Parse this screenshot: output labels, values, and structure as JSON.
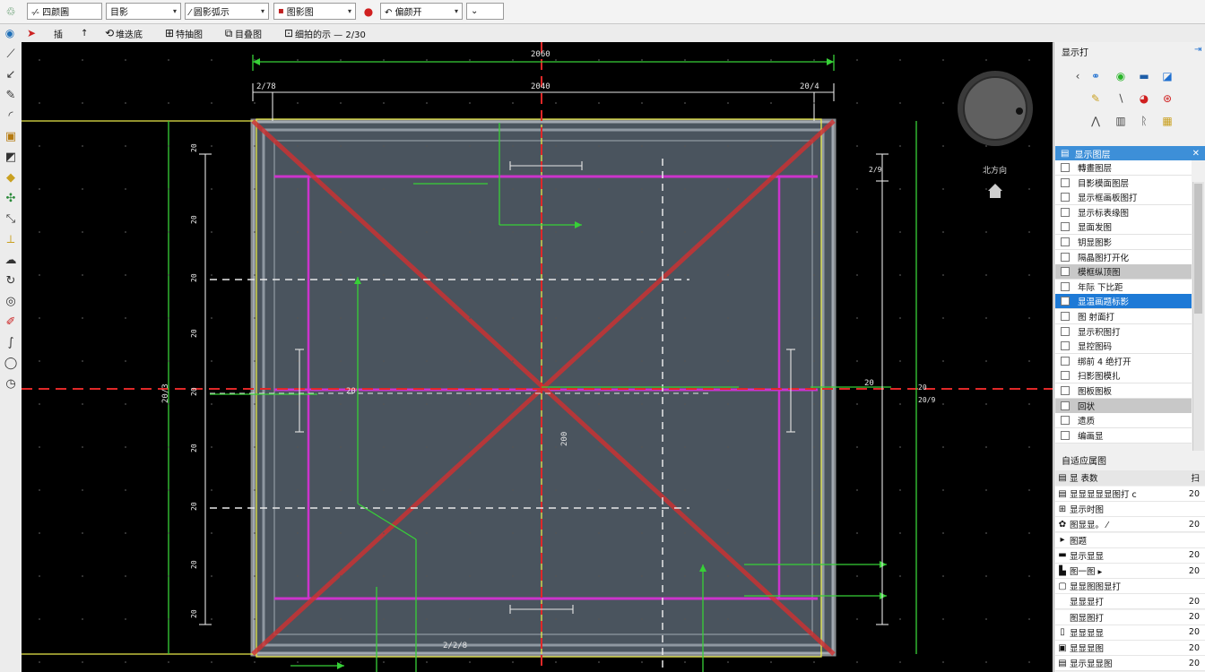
{
  "toolbar": {
    "combos": [
      {
        "label": "-⁄- 四颜圖",
        "icon": "line-style-icon"
      },
      {
        "label": "目影",
        "icon": "layer-icon"
      },
      {
        "label": "⁄ 圆影弧示",
        "icon": "arc-icon"
      },
      {
        "label": "图影图",
        "icon": "color-icon"
      },
      {
        "label": "↶ 偏颜开",
        "icon": "undo-icon"
      }
    ],
    "extra": "⌄"
  },
  "toolbar2": {
    "items": [
      "插",
      "↑",
      "堆迭底",
      "特抽图",
      "目叠图",
      "细拍的示 — 2/30"
    ]
  },
  "canvas": {
    "dim_top_outer": "2060",
    "dim_top_inner": "2040",
    "dim_left_top": "2/78",
    "dim_right_top": "20/4",
    "dim_mid_small": "→ —",
    "dim_bottom": "2/2/8",
    "left_dims": [
      "20",
      "20",
      "20",
      "20",
      "20",
      "20",
      "20",
      "20",
      "20"
    ],
    "left_outer_dim": "20/3",
    "right_dims": [
      "2/9",
      "20",
      "20/9"
    ],
    "center_dim": "200",
    "mid_left_dim": "20",
    "mid_right_dim": "20"
  },
  "view": {
    "compass_label": "北方向",
    "home_icon": "house-icon"
  },
  "panel": {
    "title": "显示打",
    "pin": "⇥",
    "close": "✕",
    "layers_header": "显示图层",
    "layers": [
      {
        "label": "轉畫图层",
        "state": "normal"
      },
      {
        "label": "目影模面图层",
        "state": "normal"
      },
      {
        "label": "显示框画板图打",
        "state": "normal"
      },
      {
        "label": "显示标表缘图",
        "state": "normal"
      },
      {
        "label": "显面发图",
        "state": "normal"
      },
      {
        "label": "钥显图影",
        "state": "normal"
      },
      {
        "label": "隔晶图打开化",
        "state": "normal"
      },
      {
        "label": "模框纵顶图",
        "state": "grey"
      },
      {
        "label": "年际 下比距",
        "state": "normal"
      },
      {
        "label": "显温画题标影",
        "state": "selected"
      },
      {
        "label": "图 射面打",
        "state": "normal"
      },
      {
        "label": "显示积图打",
        "state": "normal"
      },
      {
        "label": "显控图码",
        "state": "normal"
      },
      {
        "label": "绑前 4 绝打开",
        "state": "normal"
      },
      {
        "label": "扫影图模扎",
        "state": "normal"
      },
      {
        "label": "图板图板",
        "state": "normal"
      },
      {
        "label": "回状",
        "state": "grey"
      },
      {
        "label": "遗质",
        "state": "normal"
      },
      {
        "label": "编画显",
        "state": "normal"
      }
    ],
    "props_title": "自适应属图",
    "props_header": {
      "name": "显 表数",
      "value": "扫"
    },
    "props": [
      {
        "icon": "layer-icon",
        "label": "显显显显显图打 c",
        "value": "20"
      },
      {
        "icon": "grid-icon",
        "label": "显示时图",
        "value": ""
      },
      {
        "icon": "palette-icon",
        "label": "图显显。 ⁄",
        "value": "20"
      },
      {
        "icon": "expand-icon",
        "label": "图题",
        "value": ""
      },
      {
        "icon": "line-icon",
        "label": "显示显显",
        "value": "20"
      },
      {
        "icon": "print-icon",
        "label": "图一图 ▸",
        "value": "20"
      },
      {
        "icon": "box-icon",
        "label": "显显图图显打",
        "value": ""
      },
      {
        "icon": "none",
        "label": "显显显打",
        "value": "20"
      },
      {
        "icon": "none",
        "label": "图显图打",
        "value": "20"
      },
      {
        "icon": "bar-icon",
        "label": "显显显显",
        "value": "20"
      },
      {
        "icon": "save-icon",
        "label": "显显显图",
        "value": "20"
      },
      {
        "icon": "text-icon",
        "label": "显示显显图",
        "value": "20"
      }
    ]
  }
}
